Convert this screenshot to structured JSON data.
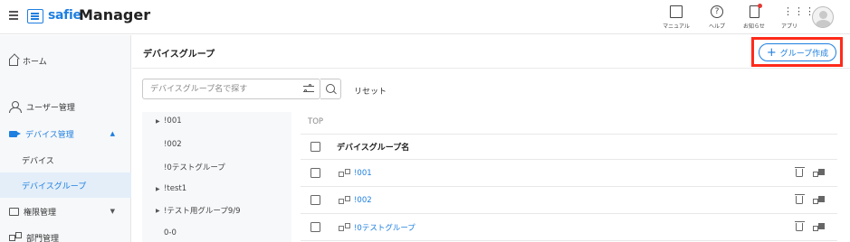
{
  "app": {
    "logo_brand": "safie",
    "logo_product": "Manager"
  },
  "header": {
    "manual_label": "マニュアル",
    "help_label": "ヘルプ",
    "notice_label": "お知らせ",
    "apps_label": "アプリ"
  },
  "sidebar": {
    "home": "ホーム",
    "users": "ユーザー管理",
    "devices": "デバイス管理",
    "device_sub": "デバイス",
    "device_group_sub": "デバイスグループ",
    "permissions": "権限管理",
    "departments": "部門管理"
  },
  "main": {
    "title": "デバイスグループ",
    "create_button": "グループ作成",
    "search_placeholder": "デバイスグループ名で探す",
    "reset_label": "リセット",
    "breadcrumb": "TOP"
  },
  "tree": [
    {
      "label": "!001",
      "expandable": true
    },
    {
      "label": "!002",
      "expandable": false
    },
    {
      "label": "!0テストグループ",
      "expandable": false
    },
    {
      "label": "!test1",
      "expandable": true
    },
    {
      "label": "!テスト用グループ9/9",
      "expandable": true
    },
    {
      "label": "0-0",
      "expandable": false
    }
  ],
  "table": {
    "header": "デバイスグループ名",
    "rows": [
      {
        "name": "!001"
      },
      {
        "name": "!002"
      },
      {
        "name": "!0テストグループ"
      }
    ]
  },
  "colors": {
    "accent": "#1e7fe0",
    "highlight": "#ff2a1a",
    "notification_dot": "#e53935"
  }
}
